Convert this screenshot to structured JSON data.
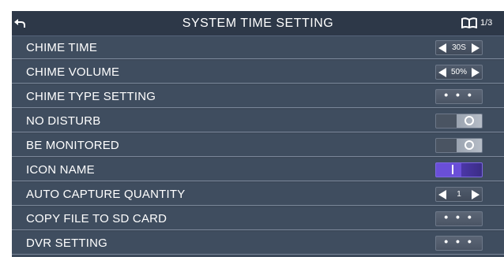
{
  "header": {
    "title": "SYSTEM TIME SETTING",
    "page_indicator": "1/3",
    "back_icon": "back-arrow-icon",
    "book_icon": "book-icon"
  },
  "rows": [
    {
      "label": "CHIME TIME",
      "control": "stepper",
      "value": "30S"
    },
    {
      "label": "CHIME VOLUME",
      "control": "stepper",
      "value": "50%"
    },
    {
      "label": "CHIME TYPE SETTING",
      "control": "more",
      "value": "• • •"
    },
    {
      "label": "NO DISTURB",
      "control": "toggle",
      "state": "off"
    },
    {
      "label": "BE MONITORED",
      "control": "toggle",
      "state": "off"
    },
    {
      "label": "ICON NAME",
      "control": "toggle",
      "state": "on"
    },
    {
      "label": "AUTO CAPTURE QUANTITY",
      "control": "stepper",
      "value": "1"
    },
    {
      "label": "COPY FILE TO SD CARD",
      "control": "more",
      "value": "• • •"
    },
    {
      "label": "DVR SETTING",
      "control": "more",
      "value": "• • •"
    }
  ],
  "colors": {
    "panel_bg": "#3d4a5b",
    "header_bg": "#2d3848",
    "toggle_on": "#6a4fd8",
    "text": "#ffffff"
  }
}
